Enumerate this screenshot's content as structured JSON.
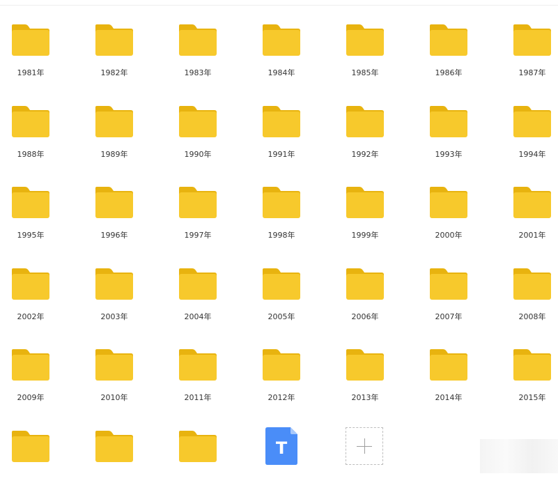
{
  "folders": [
    {
      "label": "1981年"
    },
    {
      "label": "1982年"
    },
    {
      "label": "1983年"
    },
    {
      "label": "1984年"
    },
    {
      "label": "1985年"
    },
    {
      "label": "1986年"
    },
    {
      "label": "1987年"
    },
    {
      "label": "1988年"
    },
    {
      "label": "1989年"
    },
    {
      "label": "1990年"
    },
    {
      "label": "1991年"
    },
    {
      "label": "1992年"
    },
    {
      "label": "1993年"
    },
    {
      "label": "1994年"
    },
    {
      "label": "1995年"
    },
    {
      "label": "1996年"
    },
    {
      "label": "1997年"
    },
    {
      "label": "1998年"
    },
    {
      "label": "1999年"
    },
    {
      "label": "2000年"
    },
    {
      "label": "2001年"
    },
    {
      "label": "2002年"
    },
    {
      "label": "2003年"
    },
    {
      "label": "2004年"
    },
    {
      "label": "2005年"
    },
    {
      "label": "2006年"
    },
    {
      "label": "2007年"
    },
    {
      "label": "2008年"
    },
    {
      "label": "2009年"
    },
    {
      "label": "2010年"
    },
    {
      "label": "2011年"
    },
    {
      "label": "2012年"
    },
    {
      "label": "2013年"
    },
    {
      "label": "2014年"
    },
    {
      "label": "2015年"
    },
    {
      "label": ""
    },
    {
      "label": ""
    },
    {
      "label": ""
    }
  ],
  "document": {
    "icon": "text-document-icon",
    "glyph": "T",
    "color": "#4a8df8"
  },
  "add_button": {
    "icon": "plus-icon"
  },
  "colors": {
    "folder_front": "#f7c92c",
    "folder_back": "#e8b30f"
  }
}
